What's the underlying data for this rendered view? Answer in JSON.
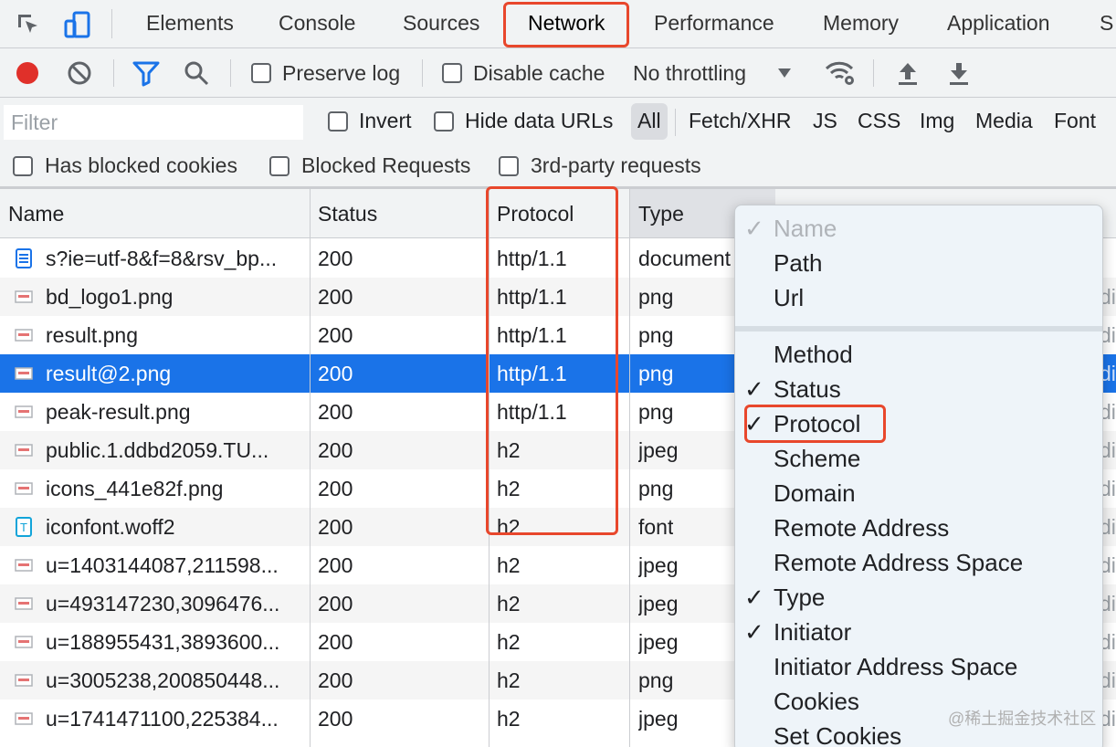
{
  "tabs": [
    "Elements",
    "Console",
    "Sources",
    "Network",
    "Performance",
    "Memory",
    "Application",
    "S"
  ],
  "active_tab": "Network",
  "toolbar": {
    "preserve_log": "Preserve log",
    "disable_cache": "Disable cache",
    "throttling": "No throttling",
    "record_color": "#e0302a"
  },
  "filter": {
    "placeholder": "Filter",
    "invert": "Invert",
    "hide_data_urls": "Hide data URLs",
    "types": [
      "All",
      "Fetch/XHR",
      "JS",
      "CSS",
      "Img",
      "Media",
      "Font"
    ],
    "has_blocked_cookies": "Has blocked cookies",
    "blocked_requests": "Blocked Requests",
    "third_party": "3rd-party requests"
  },
  "columns": {
    "name": "Name",
    "status": "Status",
    "protocol": "Protocol",
    "type": "Type"
  },
  "rows": [
    {
      "icon": "document-icon",
      "name": "s?ie=utf-8&f=8&rsv_bp...",
      "status": "200",
      "protocol": "http/1.1",
      "type": "document",
      "more": ""
    },
    {
      "icon": "image-icon",
      "name": "bd_logo1.png",
      "status": "200",
      "protocol": "http/1.1",
      "type": "png",
      "more": "di"
    },
    {
      "icon": "image-icon",
      "name": "result.png",
      "status": "200",
      "protocol": "http/1.1",
      "type": "png",
      "more": "di"
    },
    {
      "icon": "image-icon",
      "name": "result@2.png",
      "status": "200",
      "protocol": "http/1.1",
      "type": "png",
      "more": "di"
    },
    {
      "icon": "image-icon",
      "name": "peak-result.png",
      "status": "200",
      "protocol": "http/1.1",
      "type": "png",
      "more": "di"
    },
    {
      "icon": "image-icon",
      "name": "public.1.ddbd2059.TU...",
      "status": "200",
      "protocol": "h2",
      "type": "jpeg",
      "more": "di"
    },
    {
      "icon": "image-icon",
      "name": "icons_441e82f.png",
      "status": "200",
      "protocol": "h2",
      "type": "png",
      "more": "di"
    },
    {
      "icon": "font-icon",
      "name": "iconfont.woff2",
      "status": "200",
      "protocol": "h2",
      "type": "font",
      "more": "di"
    },
    {
      "icon": "image-icon",
      "name": "u=1403144087,211598...",
      "status": "200",
      "protocol": "h2",
      "type": "jpeg",
      "more": "di"
    },
    {
      "icon": "image-icon",
      "name": "u=493147230,3096476...",
      "status": "200",
      "protocol": "h2",
      "type": "jpeg",
      "more": "di"
    },
    {
      "icon": "image-icon",
      "name": "u=188955431,3893600...",
      "status": "200",
      "protocol": "h2",
      "type": "jpeg",
      "more": "di"
    },
    {
      "icon": "image-icon",
      "name": "u=3005238,200850448...",
      "status": "200",
      "protocol": "h2",
      "type": "png",
      "more": "di"
    },
    {
      "icon": "image-icon",
      "name": "u=1741471100,225384...",
      "status": "200",
      "protocol": "h2",
      "type": "jpeg",
      "more": "di"
    }
  ],
  "selected_row": "result@2.png",
  "context_menu": {
    "items": [
      {
        "label": "Name",
        "checked": true,
        "disabled": true
      },
      {
        "label": "Path",
        "checked": false,
        "disabled": false
      },
      {
        "label": "Url",
        "checked": false,
        "disabled": false
      },
      {
        "label": "Method",
        "checked": false,
        "disabled": false
      },
      {
        "label": "Status",
        "checked": true,
        "disabled": false
      },
      {
        "label": "Protocol",
        "checked": true,
        "disabled": false
      },
      {
        "label": "Scheme",
        "checked": false,
        "disabled": false
      },
      {
        "label": "Domain",
        "checked": false,
        "disabled": false
      },
      {
        "label": "Remote Address",
        "checked": false,
        "disabled": false
      },
      {
        "label": "Remote Address Space",
        "checked": false,
        "disabled": false
      },
      {
        "label": "Type",
        "checked": true,
        "disabled": false
      },
      {
        "label": "Initiator",
        "checked": true,
        "disabled": false
      },
      {
        "label": "Initiator Address Space",
        "checked": false,
        "disabled": false
      },
      {
        "label": "Cookies",
        "checked": false,
        "disabled": false
      },
      {
        "label": "Set Cookies",
        "checked": false,
        "disabled": false
      }
    ],
    "check_mark": "✓"
  },
  "highlight_color": "#e8472c",
  "selection_color": "#1a73e8",
  "watermark": "@稀土掘金技术社区"
}
